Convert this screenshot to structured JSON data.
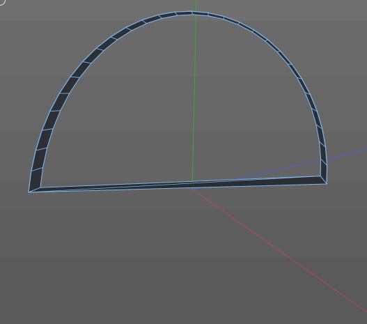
{
  "viewport": {
    "background": "#666666",
    "axis_colors": {
      "x": "#b34a4a",
      "y": "#3fa53f",
      "z": "#5a5ad0"
    },
    "object": {
      "shape": "half-cylinder-ring",
      "edge_color": "#7db6ea",
      "face_color": "#2c3036"
    },
    "icons": [
      "circle-gizmo-icon"
    ]
  }
}
